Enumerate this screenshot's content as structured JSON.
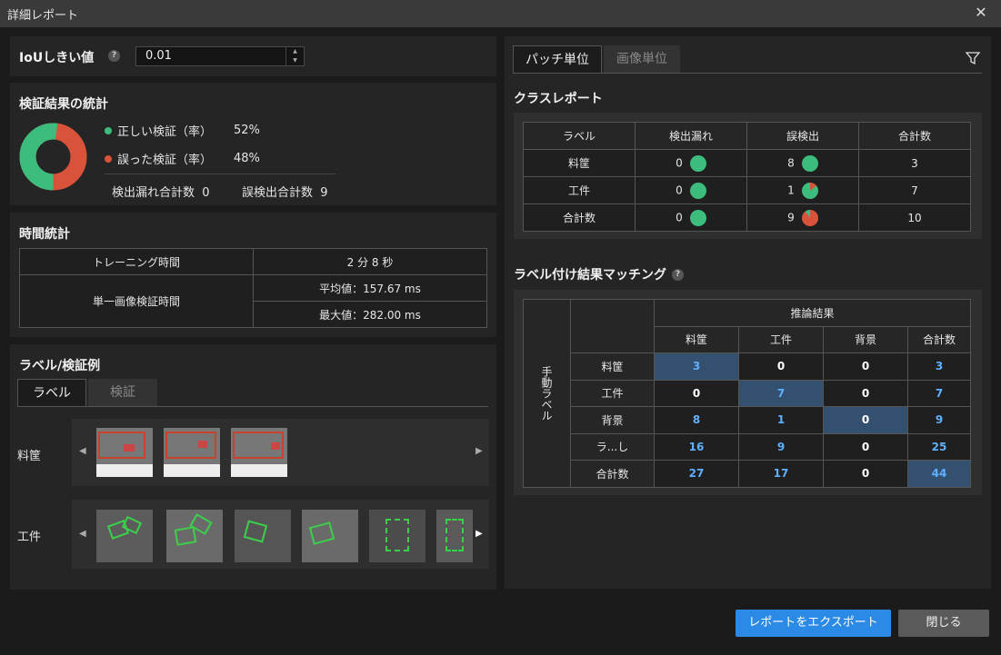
{
  "window": {
    "title": "詳細レポート"
  },
  "iou": {
    "label": "IoUしきい値",
    "value": "0.01"
  },
  "stats": {
    "title": "検証結果の統計",
    "correct_label": "正しい検証（率）",
    "correct_value": "52%",
    "wrong_label": "誤った検証（率）",
    "wrong_value": "48%",
    "missed_label": "検出漏れ合計数",
    "missed_value": "0",
    "false_label": "誤検出合計数",
    "false_value": "9",
    "correct_fraction": 0.52,
    "colors": {
      "correct": "#3dbd7d",
      "wrong": "#d9523a"
    }
  },
  "time": {
    "title": "時間統計",
    "training_label": "トレーニング時間",
    "training_value": "2 分 8 秒",
    "single_label": "単一画像検証時間",
    "avg": "平均値：157.67 ms",
    "max": "最大値：282.00 ms"
  },
  "examples": {
    "title": "ラベル/検証例",
    "tab_label": "ラベル",
    "tab_verify": "検証",
    "row1": "料筐",
    "row2": "工件"
  },
  "right_tabs": {
    "patch": "パッチ単位",
    "image": "画像単位"
  },
  "class_report": {
    "title": "クラスレポート",
    "headers": [
      "ラベル",
      "検出漏れ",
      "誤検出",
      "合計数"
    ],
    "rows": [
      {
        "label": "料筐",
        "missed": "0",
        "missed_frac": 0,
        "false": "8",
        "false_frac": 0,
        "total": "3"
      },
      {
        "label": "工件",
        "missed": "0",
        "missed_frac": 0,
        "false": "1",
        "false_frac": 0.14,
        "total": "7"
      },
      {
        "label": "合計数",
        "missed": "0",
        "missed_frac": 0,
        "false": "9",
        "false_frac": 0.9,
        "total": "10"
      }
    ]
  },
  "matching": {
    "title": "ラベル付け結果マッチング",
    "pred_header": "推論結果",
    "manual_label": "手動ラベル",
    "cols": [
      "料筐",
      "工件",
      "背景",
      "合計数"
    ],
    "rows": [
      {
        "label": "料筐",
        "cells": [
          "3",
          "0",
          "0",
          "3"
        ]
      },
      {
        "label": "工件",
        "cells": [
          "0",
          "7",
          "0",
          "7"
        ]
      },
      {
        "label": "背景",
        "cells": [
          "8",
          "1",
          "0",
          "9"
        ]
      },
      {
        "label": "ラ...し",
        "cells": [
          "16",
          "9",
          "0",
          "25"
        ]
      },
      {
        "label": "合計数",
        "cells": [
          "27",
          "17",
          "0",
          "44"
        ]
      }
    ]
  },
  "buttons": {
    "export": "レポートをエクスポート",
    "close": "閉じる"
  }
}
